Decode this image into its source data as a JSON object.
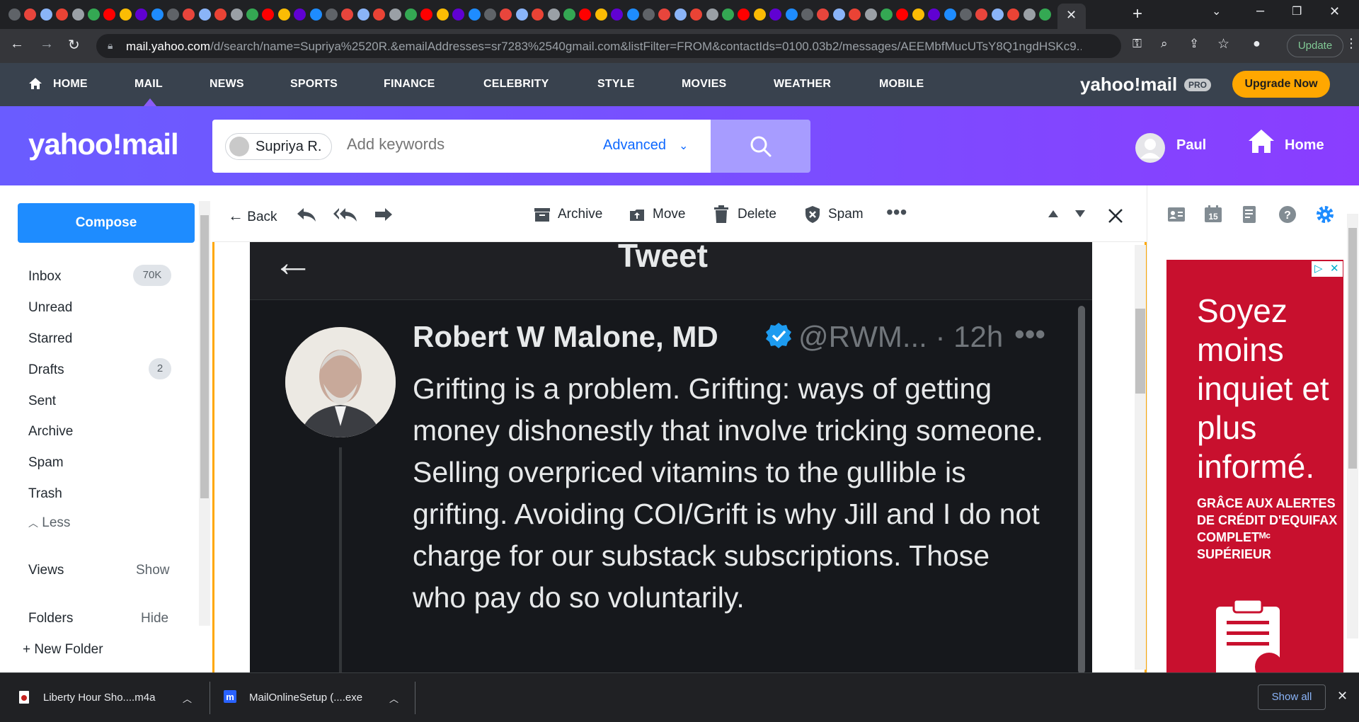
{
  "browser": {
    "url_domain": "mail.yahoo.com",
    "url_rest": "/d/search/name=Supriya%2520R.&emailAddresses=sr7283%2540gmail.com&listFilter=FROM&contactIds=0100.03b2/messages/AEEMbfMucUTsY8Q1ngdHSKc9...",
    "update_label": "Update"
  },
  "nav": {
    "items": [
      "HOME",
      "MAIL",
      "NEWS",
      "SPORTS",
      "FINANCE",
      "CELEBRITY",
      "STYLE",
      "MOVIES",
      "WEATHER",
      "MOBILE"
    ],
    "brand": "yahoo!mail",
    "pro": "PRO",
    "upgrade_label": "Upgrade Now"
  },
  "header": {
    "logo": "yahoo!mail",
    "search_chip": "Supriya R.",
    "search_placeholder": "Add keywords",
    "advanced_label": "Advanced",
    "user_name": "Paul",
    "home_label": "Home"
  },
  "sidebar": {
    "compose_label": "Compose",
    "folders": [
      {
        "label": "Inbox",
        "badge": "70K"
      },
      {
        "label": "Unread",
        "badge": ""
      },
      {
        "label": "Starred",
        "badge": ""
      },
      {
        "label": "Drafts",
        "badge": "2"
      },
      {
        "label": "Sent",
        "badge": ""
      },
      {
        "label": "Archive",
        "badge": ""
      },
      {
        "label": "Spam",
        "badge": ""
      },
      {
        "label": "Trash",
        "badge": ""
      }
    ],
    "less_label": "Less",
    "views_label": "Views",
    "views_action": "Show",
    "folders_label": "Folders",
    "folders_action": "Hide",
    "new_folder_label": "New Folder"
  },
  "toolbar": {
    "back_label": "Back",
    "archive_label": "Archive",
    "move_label": "Move",
    "delete_label": "Delete",
    "spam_label": "Spam"
  },
  "tweet": {
    "title": "Tweet",
    "author": "Robert W Malone, MD",
    "handle": "@RWM... · 12h",
    "text": "Grifting is a problem.  Grifting: ways of getting money dishonestly that involve tricking someone.  Selling overpriced vitamins to the gullible is grifting.  Avoiding COI/Grift is why Jill and I do not charge for our substack subscriptions. Those who pay do so voluntarily.",
    "more": "•••"
  },
  "ad": {
    "headline": "Soyez moins inquiet et plus informé.",
    "sub": "GRÂCE AUX ALERTES DE CRÉDIT D'EQUIFAX COMPLETᴹᶜ SUPÉRIEUR"
  },
  "downloads": {
    "items": [
      "Liberty Hour Sho....m4a",
      "MailOnlineSetup (....exe"
    ],
    "show_all": "Show all"
  },
  "colors": {
    "accent": "#7b4dff",
    "compose": "#1e8cff",
    "upgrade": "#ffa700",
    "nav_bg": "#39424e"
  }
}
